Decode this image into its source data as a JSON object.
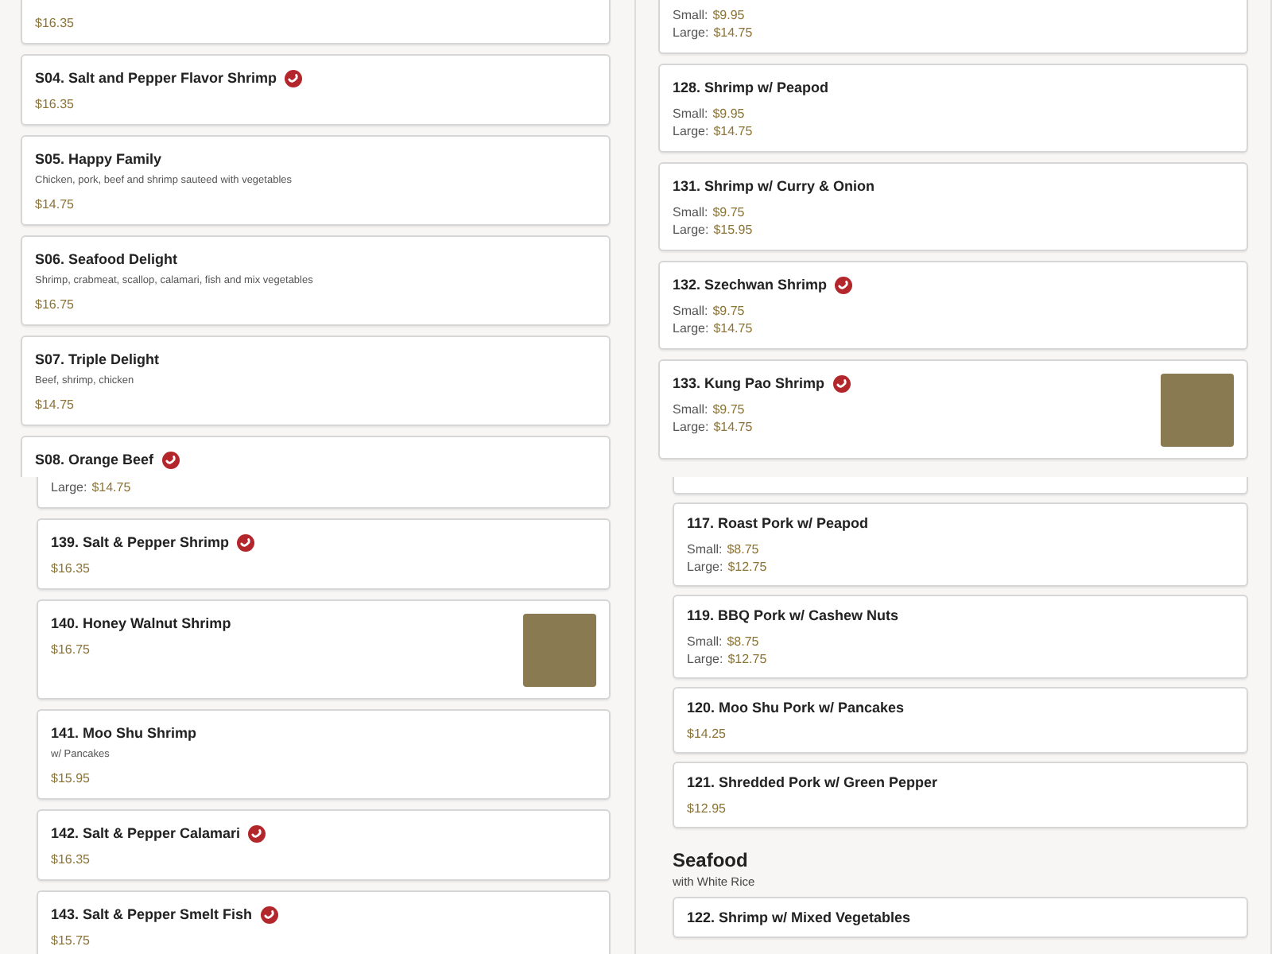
{
  "panels": [
    {
      "blocks": [
        {
          "kind": "continued",
          "prices": [
            {
              "amount": "$16.35"
            }
          ]
        },
        {
          "kind": "item",
          "title": "S04. Salt and Pepper Flavor Shrimp",
          "spicy": true,
          "prices": [
            {
              "amount": "$16.35"
            }
          ]
        },
        {
          "kind": "item",
          "title": "S05. Happy Family",
          "spicy": false,
          "description": "Chicken, pork, beef and shrimp sauteed with vegetables",
          "prices": [
            {
              "amount": "$14.75"
            }
          ]
        },
        {
          "kind": "item",
          "title": "S06. Seafood Delight",
          "spicy": false,
          "description": "Shrimp, crabmeat, scallop, calamari, fish and mix vegetables",
          "prices": [
            {
              "amount": "$16.75"
            }
          ]
        },
        {
          "kind": "item",
          "title": "S07. Triple Delight",
          "spicy": false,
          "description": "Beef, shrimp, chicken",
          "prices": [
            {
              "amount": "$14.75"
            }
          ]
        },
        {
          "kind": "item",
          "title": "S08. Orange Beef",
          "spicy": true
        }
      ]
    },
    {
      "blocks": [
        {
          "kind": "continued",
          "prices": [
            {
              "label": "Small:",
              "amount": "$9.95"
            },
            {
              "label": "Large:",
              "amount": "$14.75"
            }
          ]
        },
        {
          "kind": "item",
          "title": "128. Shrimp w/ Peapod",
          "spicy": false,
          "prices": [
            {
              "label": "Small:",
              "amount": "$9.95"
            },
            {
              "label": "Large:",
              "amount": "$14.75"
            }
          ]
        },
        {
          "kind": "item",
          "title": "131. Shrimp w/ Curry & Onion",
          "spicy": false,
          "prices": [
            {
              "label": "Small:",
              "amount": "$9.75"
            },
            {
              "label": "Large:",
              "amount": "$15.95"
            }
          ]
        },
        {
          "kind": "item",
          "title": "132. Szechwan Shrimp",
          "spicy": true,
          "prices": [
            {
              "label": "Small:",
              "amount": "$9.75"
            },
            {
              "label": "Large:",
              "amount": "$14.75"
            }
          ]
        },
        {
          "kind": "item",
          "title": "133. Kung Pao Shrimp",
          "spicy": true,
          "photo": true,
          "prices": [
            {
              "label": "Small:",
              "amount": "$9.75"
            },
            {
              "label": "Large:",
              "amount": "$14.75"
            }
          ]
        }
      ]
    },
    {
      "blocks": [
        {
          "kind": "continued",
          "prices": [
            {
              "label": "Large:",
              "amount": "$14.75"
            }
          ]
        },
        {
          "kind": "item",
          "title": "139. Salt & Pepper Shrimp",
          "spicy": true,
          "prices": [
            {
              "amount": "$16.35"
            }
          ]
        },
        {
          "kind": "item",
          "title": "140. Honey Walnut Shrimp",
          "spicy": false,
          "photo": true,
          "prices": [
            {
              "amount": "$16.75"
            }
          ]
        },
        {
          "kind": "item",
          "title": "141. Moo Shu Shrimp",
          "spicy": false,
          "description": "w/ Pancakes",
          "prices": [
            {
              "amount": "$15.95"
            }
          ]
        },
        {
          "kind": "item",
          "title": "142. Salt & Pepper Calamari",
          "spicy": true,
          "prices": [
            {
              "amount": "$16.35"
            }
          ]
        },
        {
          "kind": "item",
          "title": "143. Salt & Pepper Smelt Fish",
          "spicy": true,
          "prices": [
            {
              "amount": "$15.75"
            }
          ]
        }
      ]
    },
    {
      "blocks": [
        {
          "kind": "continued"
        },
        {
          "kind": "item",
          "title": "117. Roast Pork w/ Peapod",
          "spicy": false,
          "prices": [
            {
              "label": "Small:",
              "amount": "$8.75"
            },
            {
              "label": "Large:",
              "amount": "$12.75"
            }
          ]
        },
        {
          "kind": "item",
          "title": "119. BBQ Pork w/ Cashew Nuts",
          "spicy": false,
          "prices": [
            {
              "label": "Small:",
              "amount": "$8.75"
            },
            {
              "label": "Large:",
              "amount": "$12.75"
            }
          ]
        },
        {
          "kind": "item",
          "title": "120. Moo Shu Pork w/ Pancakes",
          "spicy": false,
          "prices": [
            {
              "amount": "$14.25"
            }
          ]
        },
        {
          "kind": "item",
          "title": "121. Shredded Pork w/ Green Pepper",
          "spicy": false,
          "prices": [
            {
              "amount": "$12.95"
            }
          ]
        },
        {
          "kind": "section",
          "title": "Seafood",
          "subtitle": "with White Rice"
        },
        {
          "kind": "item",
          "title": "122. Shrimp w/ Mixed Vegetables"
        }
      ]
    }
  ]
}
